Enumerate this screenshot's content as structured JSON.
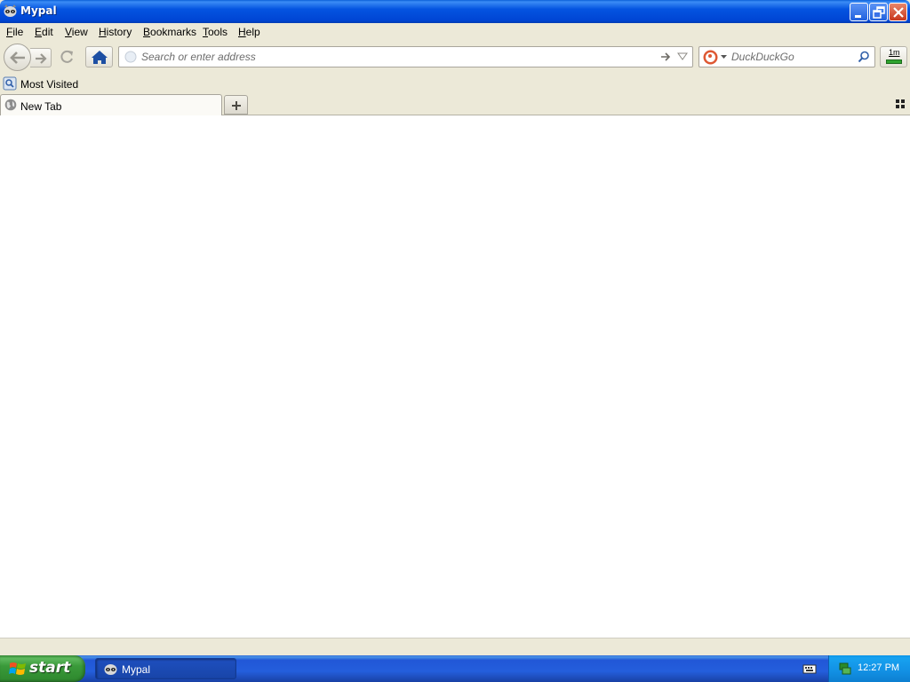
{
  "window": {
    "title": "Mypal",
    "icon": "mypal-raccoon-icon",
    "controls": [
      "minimize-icon",
      "restore-icon",
      "close-icon"
    ]
  },
  "menubar": {
    "items": [
      {
        "label": "File",
        "mnemonic": "F",
        "rest": "ile"
      },
      {
        "label": "Edit",
        "mnemonic": "E",
        "rest": "dit"
      },
      {
        "label": "View",
        "mnemonic": "V",
        "rest": "iew"
      },
      {
        "label": "History",
        "mnemonic": "H",
        "rest": "istory"
      },
      {
        "label": "Bookmarks",
        "mnemonic": "B",
        "rest": "ookmarks"
      },
      {
        "label": "Tools",
        "mnemonic": "T",
        "rest": "ools"
      },
      {
        "label": "Help",
        "mnemonic": "H",
        "rest": "elp"
      }
    ]
  },
  "navbar": {
    "back_icon": "back-arrow-icon",
    "forward_icon": "forward-arrow-icon",
    "reload_icon": "reload-icon",
    "home_icon": "home-icon",
    "address": {
      "placeholder": "Search or enter address",
      "value": ""
    },
    "search": {
      "engine": "DuckDuckGo",
      "placeholder": "DuckDuckGo",
      "value": ""
    },
    "downloads_label": "1m"
  },
  "bookmarks": {
    "items": [
      {
        "label": "Most Visited",
        "icon": "most-visited-folder-icon"
      }
    ]
  },
  "tabs": {
    "items": [
      {
        "label": "New Tab",
        "active": true,
        "icon": "globe-icon"
      }
    ],
    "new_tab_icon": "plus-icon",
    "tab_list_icon": "grid-icon"
  },
  "taskbar": {
    "start_label": "start",
    "tasks": [
      {
        "label": "Mypal",
        "icon": "mypal-raccoon-icon"
      }
    ],
    "clock": "12:27 PM"
  },
  "colors": {
    "titlebar": "#0454e0",
    "chrome": "#ece9d8",
    "taskbar": "#245edc",
    "start_button": "#3a9a3a",
    "tray": "#1290e4"
  }
}
